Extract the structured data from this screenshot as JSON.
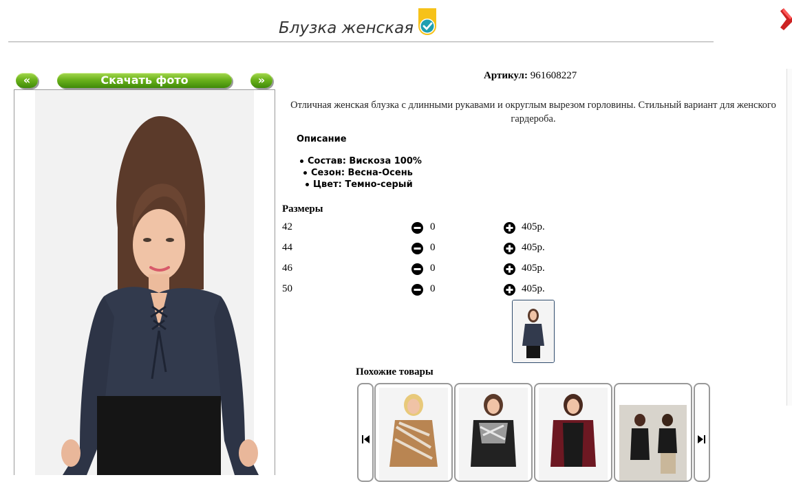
{
  "header": {
    "title": "Блузка женская"
  },
  "gallery": {
    "prev_label": "«",
    "download_label": "Скачать фото",
    "next_label": "»"
  },
  "product": {
    "article_label": "Артикул:",
    "article_value": "961608227",
    "description": "Отличная женская блузка с длинными рукавами и округлым вырезом горловины. Стильный вариант для женского гардероба.",
    "description_heading": "Описание",
    "properties": [
      "Состав: Вискоза 100%",
      "Сезон: Весна-Осень",
      "Цвет: Темно-серый"
    ]
  },
  "sizes": {
    "heading": "Размеры",
    "rows": [
      {
        "size": "42",
        "qty": "0",
        "price": "405р."
      },
      {
        "size": "44",
        "qty": "0",
        "price": "405р."
      },
      {
        "size": "46",
        "qty": "0",
        "price": "405р."
      },
      {
        "size": "50",
        "qty": "0",
        "price": "405р."
      }
    ]
  },
  "similar": {
    "heading": "Похожие товары"
  },
  "colors": {
    "button_green": "#6cb31c",
    "blouse": "#323a4d",
    "badge_yellow": "#f6c21a",
    "badge_teal": "#1f9fb0"
  }
}
